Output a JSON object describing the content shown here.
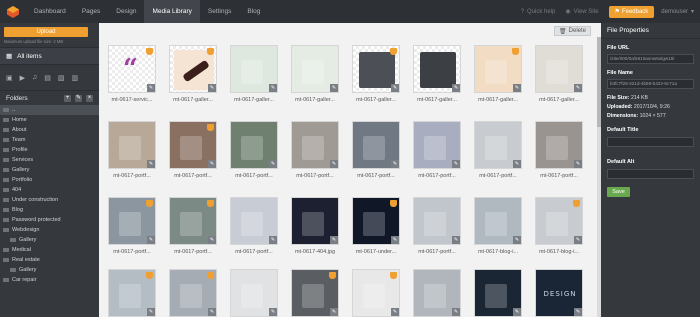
{
  "topbar": {
    "nav": [
      "Dashboard",
      "Pages",
      "Design",
      "Media Library",
      "Settings",
      "Blog"
    ],
    "active": "Media Library",
    "quick_help": "Quick help",
    "view_site": "View Site",
    "feedback": "Feedback",
    "user": "demouser"
  },
  "left": {
    "upload": "Upload",
    "upload_note": "Maximum upload file size: 2 MB",
    "all_items": "All items",
    "folders_title": "Folders",
    "root_folder": "..",
    "folders": [
      {
        "name": "Home",
        "sub": false
      },
      {
        "name": "About",
        "sub": false
      },
      {
        "name": "Team",
        "sub": false
      },
      {
        "name": "Profile",
        "sub": false
      },
      {
        "name": "Services",
        "sub": false
      },
      {
        "name": "Gallery",
        "sub": false
      },
      {
        "name": "Portfolio",
        "sub": false
      },
      {
        "name": "404",
        "sub": false
      },
      {
        "name": "Under construction",
        "sub": false
      },
      {
        "name": "Blog",
        "sub": false
      },
      {
        "name": "Password protected",
        "sub": false
      },
      {
        "name": "Webdesign",
        "sub": false
      },
      {
        "name": "Gallery",
        "sub": true
      },
      {
        "name": "Medical",
        "sub": false
      },
      {
        "name": "Real estate",
        "sub": false
      },
      {
        "name": "Gallery",
        "sub": true
      },
      {
        "name": "Car repair",
        "sub": false
      }
    ]
  },
  "main": {
    "delete_label": "Delete",
    "tiles": [
      {
        "caption": "mt-0617-servic...",
        "kind": "quote",
        "color": "#a23ea0",
        "badge": true,
        "selected": false
      },
      {
        "caption": "mt-0617-galler...",
        "kind": "bottle",
        "color": "#f5e3d3",
        "badge": true,
        "selected": false
      },
      {
        "caption": "mt-0617-galler...",
        "kind": "photo",
        "color": "#dfe8df",
        "badge": false,
        "selected": false
      },
      {
        "caption": "mt-0617-galler...",
        "kind": "photo",
        "color": "#e4ece4",
        "badge": false,
        "selected": false
      },
      {
        "caption": "mt-0617-galler...",
        "kind": "shirt",
        "color": "#4c4f55",
        "badge": true,
        "selected": false
      },
      {
        "caption": "mt-0617-galler...",
        "kind": "shirt",
        "color": "#3c3f44",
        "badge": false,
        "selected": false
      },
      {
        "caption": "mt-0617-galler...",
        "kind": "photo",
        "color": "#f3dcc4",
        "badge": true,
        "selected": false
      },
      {
        "caption": "mt-0617-galler...",
        "kind": "photo",
        "color": "#e0dcd6",
        "badge": false,
        "selected": false
      },
      {
        "caption": "mt-0617-portf...",
        "kind": "photo",
        "color": "#b8a898",
        "badge": false,
        "selected": false
      },
      {
        "caption": "mt-0617-portf...",
        "kind": "photo",
        "color": "#8a7060",
        "badge": true,
        "selected": false
      },
      {
        "caption": "mt-0617-portf...",
        "kind": "photo",
        "color": "#6f7f70",
        "badge": false,
        "selected": false
      },
      {
        "caption": "mt-0617-portf...",
        "kind": "photo",
        "color": "#a09a94",
        "badge": false,
        "selected": false
      },
      {
        "caption": "mt-0617-portf...",
        "kind": "photo",
        "color": "#707884",
        "badge": false,
        "selected": false
      },
      {
        "caption": "mt-0617-portf...",
        "kind": "photo",
        "color": "#a8aec0",
        "badge": false,
        "selected": false
      },
      {
        "caption": "mt-0617-portf...",
        "kind": "photo",
        "color": "#c8ccd0",
        "badge": false,
        "selected": false
      },
      {
        "caption": "mt-0617-portf...",
        "kind": "photo",
        "color": "#9a9490",
        "badge": false,
        "selected": false
      },
      {
        "caption": "mt-0617-portf...",
        "kind": "photo",
        "color": "#8c96a0",
        "badge": true,
        "selected": false
      },
      {
        "caption": "mt-0617-portf...",
        "kind": "photo",
        "color": "#7c8a86",
        "badge": true,
        "selected": false
      },
      {
        "caption": "mt-0617-portf...",
        "kind": "photo",
        "color": "#c8ccd4",
        "badge": false,
        "selected": false
      },
      {
        "caption": "mt-0617-404.jpg",
        "kind": "photo",
        "color": "#1c2030",
        "badge": false,
        "selected": false
      },
      {
        "caption": "mt-0617-under...",
        "kind": "photo",
        "color": "#101828",
        "badge": true,
        "selected": false
      },
      {
        "caption": "mt-0617-portf...",
        "kind": "photo",
        "color": "#c0c6cc",
        "badge": false,
        "selected": false
      },
      {
        "caption": "mt-0617-blog-i...",
        "kind": "photo",
        "color": "#b0b8c0",
        "badge": false,
        "selected": false
      },
      {
        "caption": "mt-0617-blog-i...",
        "kind": "photo",
        "color": "#c8ccd0",
        "badge": true,
        "selected": false
      },
      {
        "caption": "",
        "kind": "photo",
        "color": "#b4bcc4",
        "badge": true,
        "selected": false
      },
      {
        "caption": "",
        "kind": "photo",
        "color": "#a6acb4",
        "badge": true,
        "selected": false
      },
      {
        "caption": "",
        "kind": "photo",
        "color": "#e0e2e4",
        "badge": false,
        "selected": false
      },
      {
        "caption": "",
        "kind": "photo",
        "color": "#5a5e62",
        "badge": true,
        "selected": false
      },
      {
        "caption": "",
        "kind": "photo",
        "color": "#e8e8e8",
        "badge": true,
        "selected": false
      },
      {
        "caption": "",
        "kind": "photo",
        "color": "#b0b6bc",
        "badge": false,
        "selected": false
      },
      {
        "caption": "",
        "kind": "photo",
        "color": "#1a2634",
        "badge": false,
        "selected": false
      },
      {
        "caption": "",
        "kind": "design",
        "color": "#1a2636",
        "text": "DESIGN",
        "badge": false,
        "selected": false
      }
    ]
  },
  "right": {
    "title": "File Properties",
    "file_url_label": "File URL",
    "file_url": "/site/000/0a/5610aonw6olgw15l",
    "file_name_label": "File Name",
    "file_name": "b3fc7f28-321d-4b59-b422-6c71a",
    "size_label": "File Size:",
    "size": "214 KB",
    "uploaded_label": "Uploaded:",
    "uploaded": "2017/10/4, 9:26",
    "dimensions_label": "Dimensions:",
    "dimensions": "1024 × 577",
    "default_title_label": "Default Title",
    "default_alt_label": "Default Alt",
    "save": "Save"
  },
  "colors": {
    "accent": "#f0a030",
    "save": "#6aa84f",
    "topbar": "#2d3035",
    "panel": "#35393e"
  }
}
